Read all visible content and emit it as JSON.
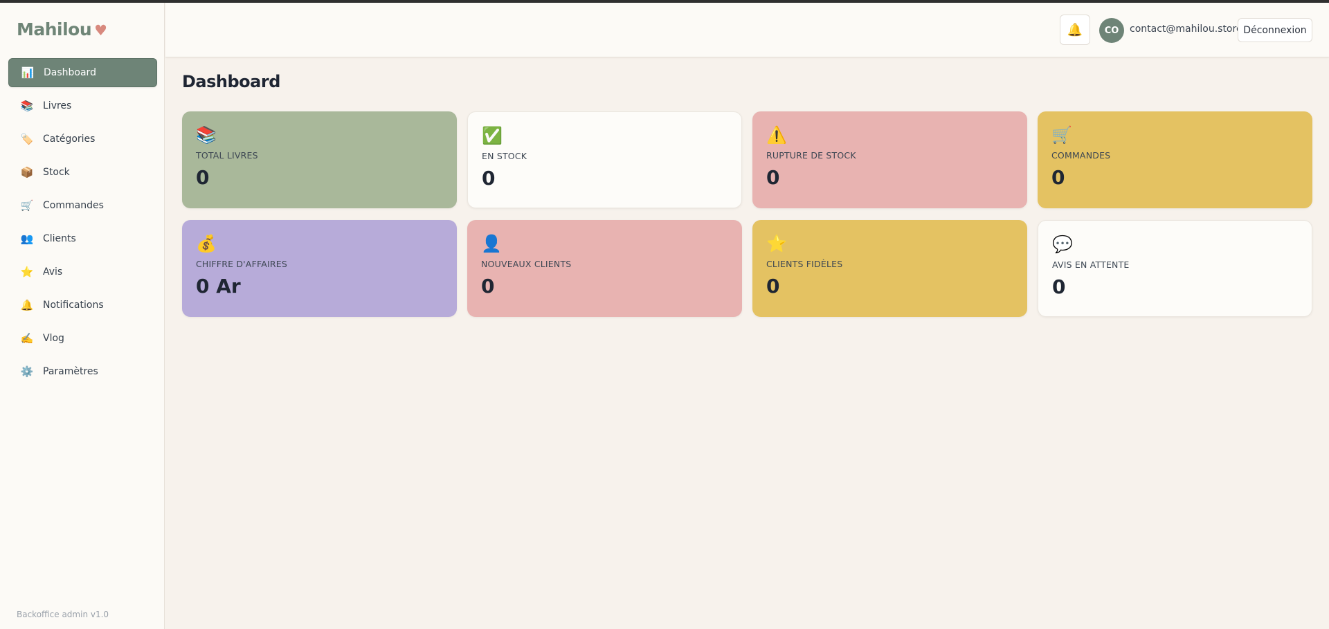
{
  "app": {
    "brand": "Mahilou",
    "brand_heart": "♥",
    "version": "Backoffice admin v1.0"
  },
  "sidebar": {
    "items": [
      {
        "label": "Dashboard",
        "icon": "📊",
        "icon_name": "chart-icon",
        "active": true
      },
      {
        "label": "Livres",
        "icon": "📚",
        "icon_name": "books-icon",
        "active": false
      },
      {
        "label": "Catégories",
        "icon": "🏷️",
        "icon_name": "tag-icon",
        "active": false
      },
      {
        "label": "Stock",
        "icon": "📦",
        "icon_name": "box-icon",
        "active": false
      },
      {
        "label": "Commandes",
        "icon": "🛒",
        "icon_name": "cart-icon",
        "active": false
      },
      {
        "label": "Clients",
        "icon": "👥",
        "icon_name": "users-icon",
        "active": false
      },
      {
        "label": "Avis",
        "icon": "⭐",
        "icon_name": "star-icon",
        "active": false
      },
      {
        "label": "Notifications",
        "icon": "🔔",
        "icon_name": "bell-icon",
        "active": false
      },
      {
        "label": "Vlog",
        "icon": "✍️",
        "icon_name": "writing-hand-icon",
        "active": false
      },
      {
        "label": "Paramètres",
        "icon": "⚙️",
        "icon_name": "gear-icon",
        "active": false
      }
    ]
  },
  "header": {
    "bell_icon": "🔔",
    "avatar_initials": "CO",
    "user_email": "contact@mahilou.store",
    "logout_label": "Déconnexion"
  },
  "main": {
    "title": "Dashboard",
    "cards": [
      {
        "icon": "📚",
        "icon_name": "books-icon",
        "label": "TOTAL LIVRES",
        "value": "0",
        "bg": "#a9b89a"
      },
      {
        "icon": "✅",
        "icon_name": "check-mark-icon",
        "label": "EN STOCK",
        "value": "0",
        "bg": "#fdfcf9"
      },
      {
        "icon": "⚠️",
        "icon_name": "warning-icon",
        "label": "RUPTURE DE STOCK",
        "value": "0",
        "bg": "#e8b3b1"
      },
      {
        "icon": "🛒",
        "icon_name": "cart-icon",
        "label": "COMMANDES",
        "value": "0",
        "bg": "#e4c262"
      },
      {
        "icon": "💰",
        "icon_name": "money-bag-icon",
        "label": "CHIFFRE D'AFFAIRES",
        "value": "0 Ar",
        "bg": "#b7abd9"
      },
      {
        "icon": "👤",
        "icon_name": "user-icon",
        "label": "NOUVEAUX CLIENTS",
        "value": "0",
        "bg": "#e8b3b1"
      },
      {
        "icon": "⭐",
        "icon_name": "star-icon",
        "label": "CLIENTS FIDÈLES",
        "value": "0",
        "bg": "#e4c262"
      },
      {
        "icon": "💬",
        "icon_name": "speech-bubble-icon",
        "label": "AVIS EN ATTENTE",
        "value": "0",
        "bg": "#fdfcf9"
      }
    ]
  }
}
